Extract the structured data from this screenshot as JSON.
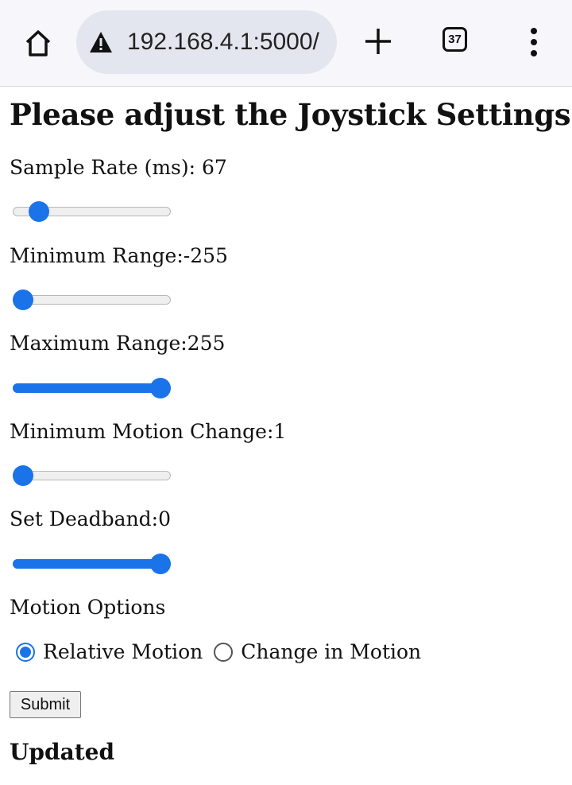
{
  "browser": {
    "url": "192.168.4.1:5000/",
    "tab_count": "37",
    "icons": [
      "home-icon",
      "warning-icon",
      "plus-icon",
      "tabs-icon",
      "menu-icon"
    ]
  },
  "page": {
    "title": "Please adjust the Joystick Settings",
    "sample_rate_label": "Sample Rate (ms): 67",
    "min_range_label": "Minimum Range:-255",
    "max_range_label": "Maximum Range:255",
    "min_motion_label": "Minimum Motion Change:1",
    "deadband_label": "Set Deadband:0",
    "motion_options_label": "Motion Options",
    "relative_motion_label": "Relative Motion",
    "change_in_motion_label": "Change in Motion",
    "submit_label": "Submit",
    "status": "Updated"
  },
  "sliders": {
    "sample_rate": 0.16,
    "min_range": 0.06,
    "max_range": 0.94,
    "min_motion": 0.06,
    "deadband": 0.94
  },
  "motion_option_selected": "Relative Motion",
  "colors": {
    "accent": "#1a73e8"
  }
}
